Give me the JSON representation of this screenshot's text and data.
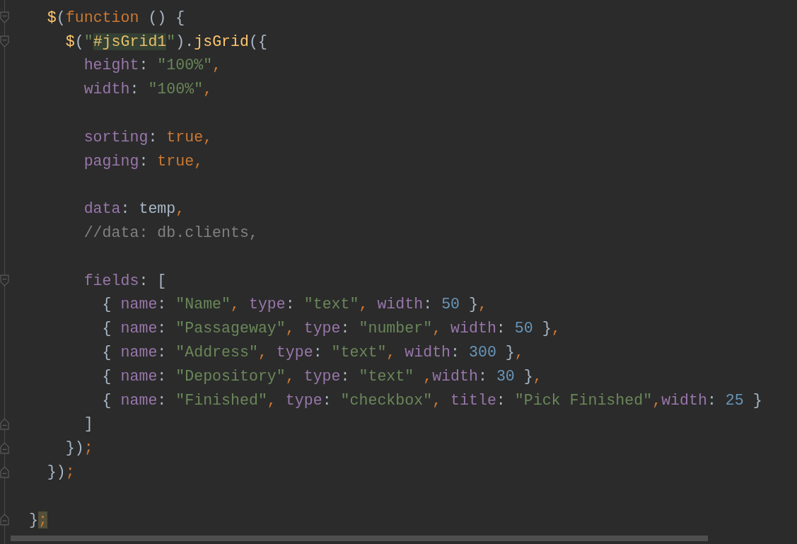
{
  "editor": {
    "lines": [
      {
        "kind": "hidden",
        "children": [
          {
            "kind": "code",
            "fold_start": true,
            "fold_end": false,
            "tokens": [
              {
                "kind": "fn",
                "text": "$"
              },
              {
                "kind": "plain",
                "text": "("
              },
              {
                "kind": "kw",
                "text": "function"
              },
              {
                "kind": "plain",
                "text": " () {"
              }
            ],
            "children": [
              {
                "kind": "code",
                "fold_start": true,
                "fold_end": false,
                "tokens": [
                  {
                    "kind": "fn",
                    "text": "$"
                  },
                  {
                    "kind": "plain",
                    "text": "("
                  },
                  {
                    "kind": "str",
                    "text": "\""
                  },
                  {
                    "kind": "match",
                    "text": "#jsGrid1"
                  },
                  {
                    "kind": "str",
                    "text": "\""
                  },
                  {
                    "kind": "plain",
                    "text": ")."
                  },
                  {
                    "kind": "fn",
                    "text": "jsGrid"
                  },
                  {
                    "kind": "plain",
                    "text": "({"
                  }
                ],
                "children": [
                  {
                    "kind": "code",
                    "fold_start": false,
                    "fold_end": false,
                    "tokens": [
                      {
                        "kind": "prop",
                        "text": "height"
                      },
                      {
                        "kind": "plain",
                        "text": ": "
                      },
                      {
                        "kind": "str",
                        "text": "\"100%\""
                      },
                      {
                        "kind": "kw",
                        "text": ","
                      }
                    ]
                  },
                  {
                    "kind": "code",
                    "fold_start": false,
                    "fold_end": false,
                    "tokens": [
                      {
                        "kind": "prop",
                        "text": "width"
                      },
                      {
                        "kind": "plain",
                        "text": ": "
                      },
                      {
                        "kind": "str",
                        "text": "\"100%\""
                      },
                      {
                        "kind": "kw",
                        "text": ","
                      }
                    ]
                  },
                  {
                    "kind": "blank",
                    "fold_start": false,
                    "fold_end": false
                  },
                  {
                    "kind": "code",
                    "fold_start": false,
                    "fold_end": false,
                    "tokens": [
                      {
                        "kind": "prop",
                        "text": "sorting"
                      },
                      {
                        "kind": "plain",
                        "text": ": "
                      },
                      {
                        "kind": "kw",
                        "text": "true,"
                      }
                    ]
                  },
                  {
                    "kind": "code",
                    "fold_start": false,
                    "fold_end": false,
                    "tokens": [
                      {
                        "kind": "prop",
                        "text": "paging"
                      },
                      {
                        "kind": "plain",
                        "text": ": "
                      },
                      {
                        "kind": "kw",
                        "text": "true,"
                      }
                    ]
                  },
                  {
                    "kind": "blank",
                    "fold_start": false,
                    "fold_end": false
                  },
                  {
                    "kind": "code",
                    "fold_start": false,
                    "fold_end": false,
                    "tokens": [
                      {
                        "kind": "prop",
                        "text": "data"
                      },
                      {
                        "kind": "plain",
                        "text": ": temp"
                      },
                      {
                        "kind": "kw",
                        "text": ","
                      }
                    ]
                  },
                  {
                    "kind": "code",
                    "fold_start": false,
                    "fold_end": false,
                    "tokens": [
                      {
                        "kind": "comment",
                        "text": "//data: db.clients,"
                      }
                    ]
                  },
                  {
                    "kind": "blank",
                    "fold_start": false,
                    "fold_end": false
                  },
                  {
                    "kind": "code",
                    "fold_start": true,
                    "fold_end": false,
                    "tokens": [
                      {
                        "kind": "prop",
                        "text": "fields"
                      },
                      {
                        "kind": "plain",
                        "text": ": ["
                      }
                    ],
                    "children": [
                      {
                        "kind": "code",
                        "fold_start": false,
                        "fold_end": false,
                        "tokens": [
                          {
                            "kind": "plain",
                            "text": "{ "
                          },
                          {
                            "kind": "prop",
                            "text": "name"
                          },
                          {
                            "kind": "plain",
                            "text": ": "
                          },
                          {
                            "kind": "str",
                            "text": "\"Name\""
                          },
                          {
                            "kind": "kw",
                            "text": ", "
                          },
                          {
                            "kind": "prop",
                            "text": "type"
                          },
                          {
                            "kind": "plain",
                            "text": ": "
                          },
                          {
                            "kind": "str",
                            "text": "\"text\""
                          },
                          {
                            "kind": "kw",
                            "text": ", "
                          },
                          {
                            "kind": "prop",
                            "text": "width"
                          },
                          {
                            "kind": "plain",
                            "text": ": "
                          },
                          {
                            "kind": "num",
                            "text": "50"
                          },
                          {
                            "kind": "plain",
                            "text": " }"
                          },
                          {
                            "kind": "kw",
                            "text": ","
                          }
                        ]
                      },
                      {
                        "kind": "code",
                        "fold_start": false,
                        "fold_end": false,
                        "tokens": [
                          {
                            "kind": "plain",
                            "text": "{ "
                          },
                          {
                            "kind": "prop",
                            "text": "name"
                          },
                          {
                            "kind": "plain",
                            "text": ": "
                          },
                          {
                            "kind": "str",
                            "text": "\"Passageway\""
                          },
                          {
                            "kind": "kw",
                            "text": ", "
                          },
                          {
                            "kind": "prop",
                            "text": "type"
                          },
                          {
                            "kind": "plain",
                            "text": ": "
                          },
                          {
                            "kind": "str",
                            "text": "\"number\""
                          },
                          {
                            "kind": "kw",
                            "text": ", "
                          },
                          {
                            "kind": "prop",
                            "text": "width"
                          },
                          {
                            "kind": "plain",
                            "text": ": "
                          },
                          {
                            "kind": "num",
                            "text": "50"
                          },
                          {
                            "kind": "plain",
                            "text": " }"
                          },
                          {
                            "kind": "kw",
                            "text": ","
                          }
                        ]
                      },
                      {
                        "kind": "code",
                        "fold_start": false,
                        "fold_end": false,
                        "tokens": [
                          {
                            "kind": "plain",
                            "text": "{ "
                          },
                          {
                            "kind": "prop",
                            "text": "name"
                          },
                          {
                            "kind": "plain",
                            "text": ": "
                          },
                          {
                            "kind": "str",
                            "text": "\"Address\""
                          },
                          {
                            "kind": "kw",
                            "text": ", "
                          },
                          {
                            "kind": "prop",
                            "text": "type"
                          },
                          {
                            "kind": "plain",
                            "text": ": "
                          },
                          {
                            "kind": "str",
                            "text": "\"text\""
                          },
                          {
                            "kind": "kw",
                            "text": ", "
                          },
                          {
                            "kind": "prop",
                            "text": "width"
                          },
                          {
                            "kind": "plain",
                            "text": ": "
                          },
                          {
                            "kind": "num",
                            "text": "300"
                          },
                          {
                            "kind": "plain",
                            "text": " }"
                          },
                          {
                            "kind": "kw",
                            "text": ","
                          }
                        ]
                      },
                      {
                        "kind": "code",
                        "fold_start": false,
                        "fold_end": false,
                        "tokens": [
                          {
                            "kind": "plain",
                            "text": "{ "
                          },
                          {
                            "kind": "prop",
                            "text": "name"
                          },
                          {
                            "kind": "plain",
                            "text": ": "
                          },
                          {
                            "kind": "str",
                            "text": "\"Depository\""
                          },
                          {
                            "kind": "kw",
                            "text": ", "
                          },
                          {
                            "kind": "prop",
                            "text": "type"
                          },
                          {
                            "kind": "plain",
                            "text": ": "
                          },
                          {
                            "kind": "str",
                            "text": "\"text\""
                          },
                          {
                            "kind": "kw",
                            "text": " ,"
                          },
                          {
                            "kind": "prop",
                            "text": "width"
                          },
                          {
                            "kind": "plain",
                            "text": ": "
                          },
                          {
                            "kind": "num",
                            "text": "30"
                          },
                          {
                            "kind": "plain",
                            "text": " }"
                          },
                          {
                            "kind": "kw",
                            "text": ","
                          }
                        ]
                      },
                      {
                        "kind": "code",
                        "fold_start": false,
                        "fold_end": false,
                        "tokens": [
                          {
                            "kind": "plain",
                            "text": "{ "
                          },
                          {
                            "kind": "prop",
                            "text": "name"
                          },
                          {
                            "kind": "plain",
                            "text": ": "
                          },
                          {
                            "kind": "str",
                            "text": "\"Finished\""
                          },
                          {
                            "kind": "kw",
                            "text": ", "
                          },
                          {
                            "kind": "prop",
                            "text": "type"
                          },
                          {
                            "kind": "plain",
                            "text": ": "
                          },
                          {
                            "kind": "str",
                            "text": "\"checkbox\""
                          },
                          {
                            "kind": "kw",
                            "text": ", "
                          },
                          {
                            "kind": "prop",
                            "text": "title"
                          },
                          {
                            "kind": "plain",
                            "text": ": "
                          },
                          {
                            "kind": "str",
                            "text": "\"Pick Finished\""
                          },
                          {
                            "kind": "kw",
                            "text": ","
                          },
                          {
                            "kind": "prop",
                            "text": "width"
                          },
                          {
                            "kind": "plain",
                            "text": ": "
                          },
                          {
                            "kind": "num",
                            "text": "25"
                          },
                          {
                            "kind": "plain",
                            "text": " }"
                          }
                        ]
                      }
                    ]
                  },
                  {
                    "kind": "code",
                    "fold_start": false,
                    "fold_end": true,
                    "tokens": [
                      {
                        "kind": "plain",
                        "text": "]"
                      }
                    ]
                  }
                ]
              },
              {
                "kind": "code",
                "fold_start": false,
                "fold_end": true,
                "tokens": [
                  {
                    "kind": "plain",
                    "text": "})"
                  },
                  {
                    "kind": "kw",
                    "text": ";"
                  }
                ]
              }
            ]
          },
          {
            "kind": "code",
            "fold_start": false,
            "fold_end": true,
            "tokens": [
              {
                "kind": "plain",
                "text": "})"
              },
              {
                "kind": "kw",
                "text": ";"
              }
            ]
          },
          {
            "kind": "blank",
            "fold_start": false,
            "fold_end": false
          }
        ]
      },
      {
        "kind": "code",
        "fold_start": false,
        "fold_end": true,
        "tokens": [
          {
            "kind": "plain",
            "text": "}"
          },
          {
            "kind": "caret",
            "text": ";"
          }
        ]
      }
    ]
  }
}
